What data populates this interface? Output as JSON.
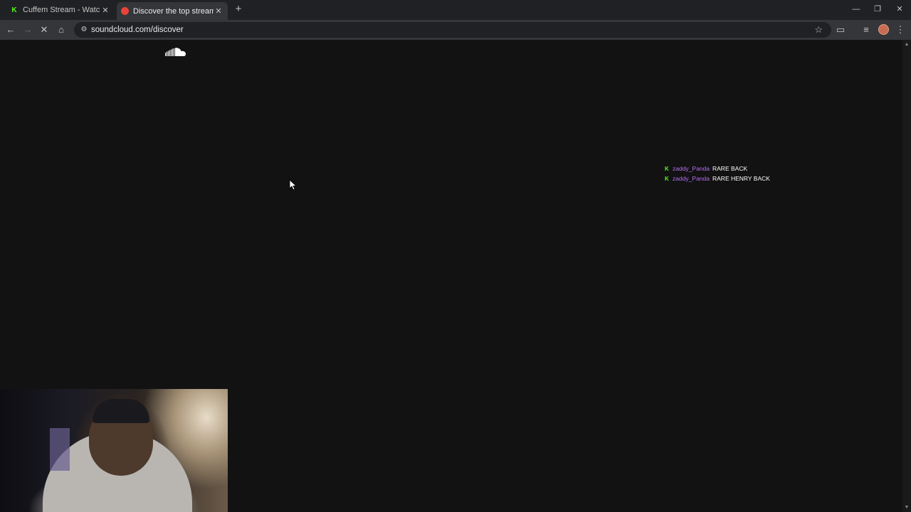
{
  "browser": {
    "tabs": [
      {
        "title": "Cuffem Stream - Watch Live on Kick",
        "favicon": "kick-icon",
        "active": false
      },
      {
        "title": "Discover the top streamed music",
        "favicon": "soundcloud-icon",
        "active": true
      }
    ],
    "new_tab": "+",
    "url": "soundcloud.com/discover",
    "controls": {
      "minimize": "—",
      "restore": "❐",
      "close": "✕"
    }
  },
  "page": {
    "logo": "soundcloud-logo-icon"
  },
  "overlay_chat": [
    {
      "user": "zaddy_Panda",
      "message": "RARE BACK"
    },
    {
      "user": "zaddy_Panda",
      "message": "RARE HENRY BACK"
    }
  ],
  "colors": {
    "background": "#121212",
    "chat_username": "#b46ef0",
    "kick_green": "#53fc18"
  }
}
